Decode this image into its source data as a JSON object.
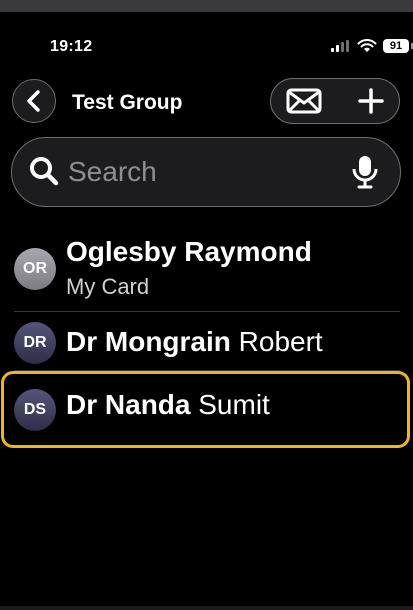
{
  "status": {
    "time": "19:12",
    "battery": "91"
  },
  "header": {
    "title": "Test Group"
  },
  "search": {
    "placeholder": "Search"
  },
  "contacts": [
    {
      "initials": "OR",
      "first_bold": "Oglesby Raymond",
      "rest": "",
      "subtitle": "My Card",
      "avatar_color": "#8e8e93"
    },
    {
      "initials": "DR",
      "first_bold": "Dr Mongrain",
      "rest": " Robert",
      "subtitle": "",
      "avatar_color": "#3a3a5c"
    },
    {
      "initials": "DS",
      "first_bold": "Dr Nanda",
      "rest": " Sumit",
      "subtitle": "",
      "avatar_color": "#3a3a5c"
    }
  ],
  "colors": {
    "highlight": "#f0b429"
  }
}
